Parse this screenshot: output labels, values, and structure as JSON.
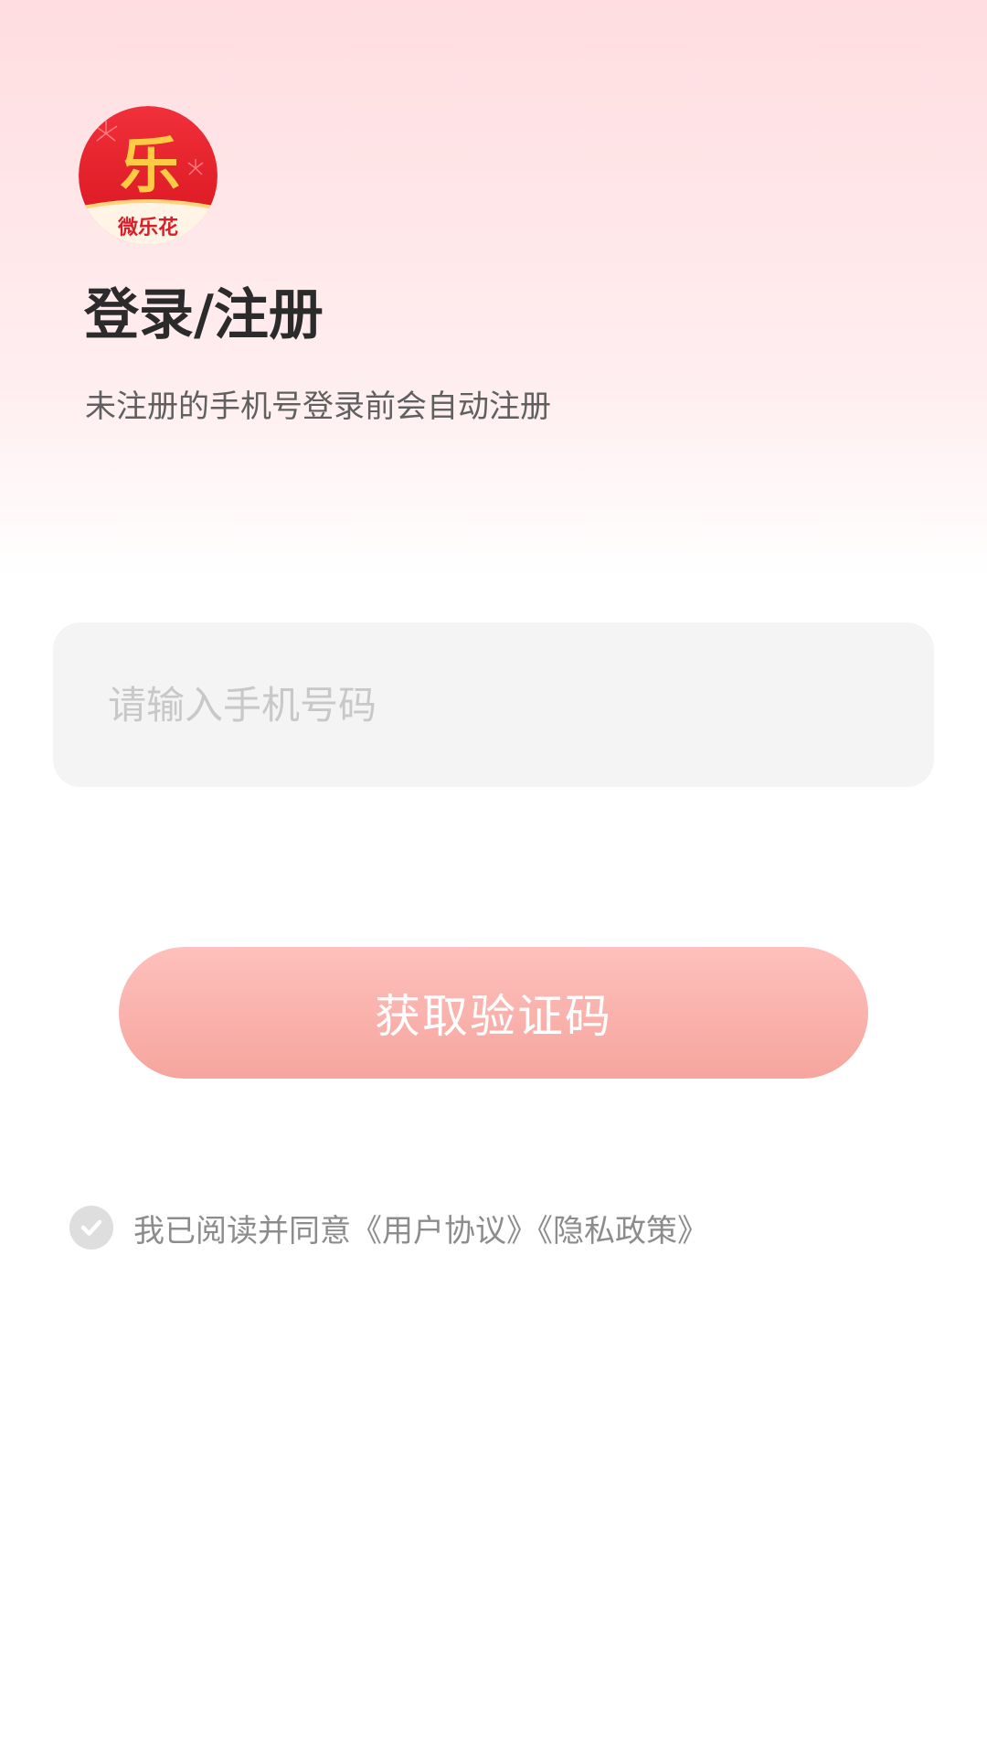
{
  "brand": {
    "logo_char": "乐",
    "logo_name": "微乐花",
    "logo_red": "#e8202d",
    "logo_gold": "#ffcb45"
  },
  "header": {
    "title": "登录/注册",
    "subtitle": "未注册的手机号登录前会自动注册"
  },
  "phone": {
    "value": "",
    "placeholder": "请输入手机号码"
  },
  "button": {
    "label": "获取验证码",
    "color_top": "#fec0bc",
    "color_bottom": "#f6a59e"
  },
  "agreement": {
    "prefix": "我已阅读并同意",
    "user_agreement": "《用户协议》",
    "privacy_policy": "《隐私政策》",
    "checked": false,
    "check_icon": "check-icon"
  }
}
